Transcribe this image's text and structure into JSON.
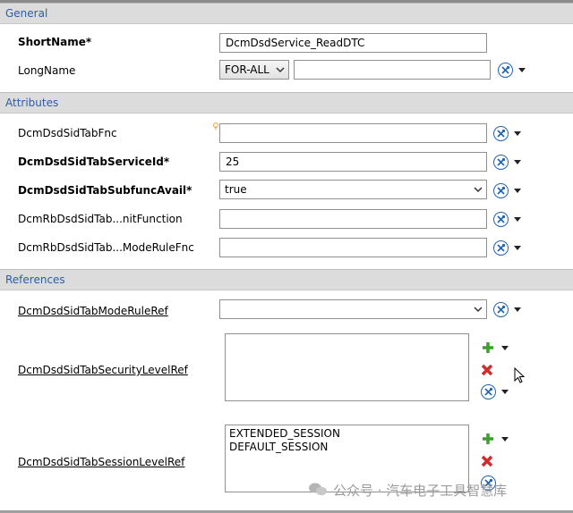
{
  "sections": {
    "general": "General",
    "attributes": "Attributes",
    "references": "References"
  },
  "general": {
    "shortname_label": "ShortName*",
    "shortname_value": "DcmDsdService_ReadDTC",
    "longname_label": "LongName",
    "longname_lang": "FOR-ALL",
    "longname_value": ""
  },
  "attributes": {
    "tabfnc_label": "DcmDsdSidTabFnc",
    "tabfnc_value": "",
    "serviceid_label": "DcmDsdSidTabServiceId*",
    "serviceid_value": "25",
    "subfunc_label": "DcmDsdSidTabSubfuncAvail*",
    "subfunc_value": "true",
    "initfn_label": "DcmRbDsdSidTab...nitFunction",
    "initfn_value": "",
    "moderulefnc_label": "DcmRbDsdSidTab...ModeRuleFnc",
    "moderulefnc_value": ""
  },
  "references": {
    "moderuleref_label": "DcmDsdSidTabModeRuleRef",
    "moderuleref_value": "",
    "securitylevelref_label": "DcmDsdSidTabSecurityLevelRef",
    "securitylevelref_items": [],
    "sessionlevelref_label": "DcmDsdSidTabSessionLevelRef",
    "sessionlevelref_items": [
      "EXTENDED_SESSION",
      "DEFAULT_SESSION"
    ]
  },
  "watermark": "公众号 · 汽车电子工具智慧库",
  "icons": {
    "action": "wrench-x-icon",
    "add": "plus-icon",
    "remove": "red-x-icon",
    "dropdown": "chevron-down-icon",
    "hint": "lightbulb-icon"
  },
  "colors": {
    "section_title": "#2b5da8",
    "section_bg": "#dcdcdc",
    "action_ring": "#1e63b4",
    "add": "#3aa02a",
    "remove": "#d42a2a"
  }
}
